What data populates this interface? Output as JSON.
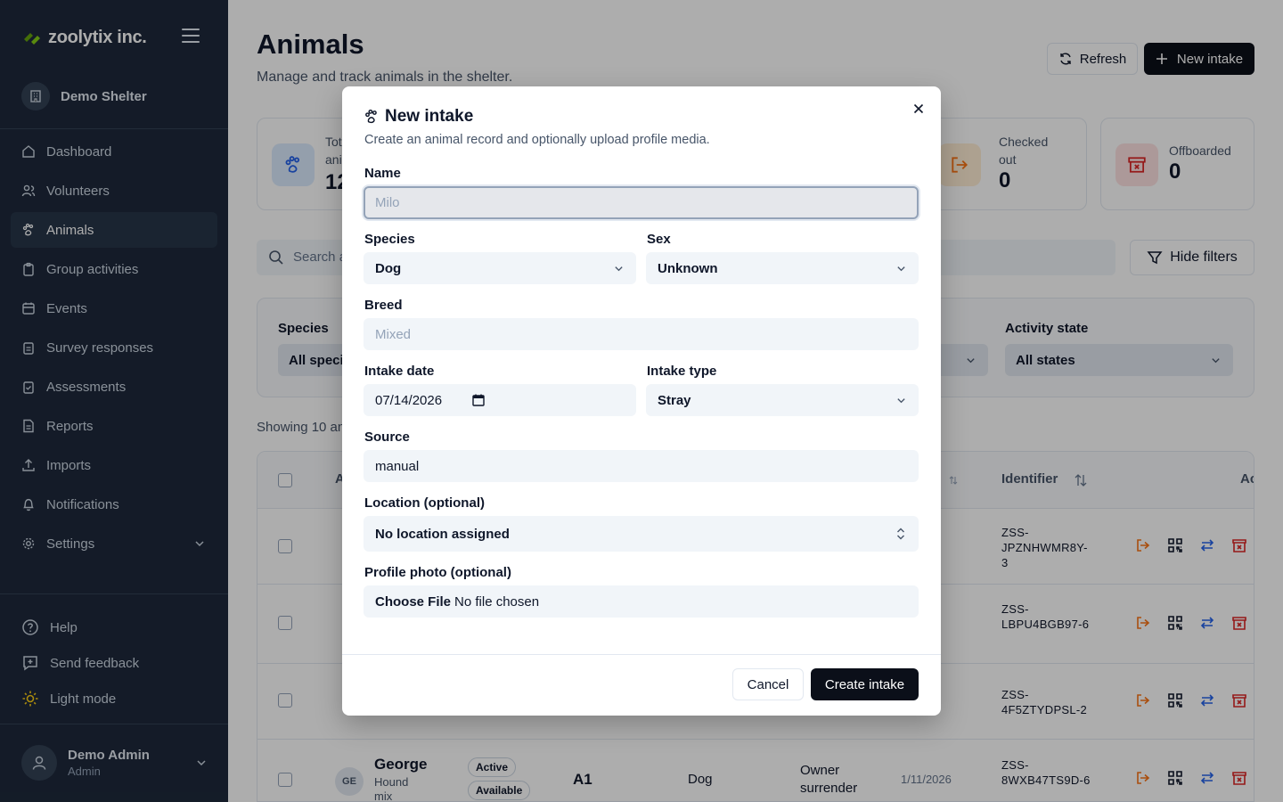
{
  "sidebar": {
    "brand": "zoolytix inc.",
    "org": "Demo Shelter",
    "nav": [
      {
        "label": "Dashboard",
        "icon": "home-icon"
      },
      {
        "label": "Volunteers",
        "icon": "users-icon"
      },
      {
        "label": "Animals",
        "icon": "paw-icon",
        "active": true
      },
      {
        "label": "Group activities",
        "icon": "clipboard-icon"
      },
      {
        "label": "Events",
        "icon": "calendar-icon"
      },
      {
        "label": "Survey responses",
        "icon": "clipboard-icon"
      },
      {
        "label": "Assessments",
        "icon": "clipboard-check-icon"
      },
      {
        "label": "Reports",
        "icon": "file-icon"
      },
      {
        "label": "Imports",
        "icon": "upload-icon"
      },
      {
        "label": "Notifications",
        "icon": "bell-icon"
      },
      {
        "label": "Settings",
        "icon": "gear-icon"
      }
    ],
    "help": "Help",
    "feedback": "Send feedback",
    "theme": "Light mode",
    "user_name": "Demo Admin",
    "user_role": "Admin"
  },
  "header": {
    "title": "Animals",
    "subtitle": "Manage and track animals in the shelter.",
    "refresh_label": "Refresh",
    "new_intake_label": "New intake"
  },
  "stats": [
    {
      "label_line1": "Tot",
      "label_line2": "ani",
      "value": "12"
    },
    {
      "label_line1": "Checked",
      "label_line2": "out",
      "value": "0"
    },
    {
      "label_line1": "Offboarded",
      "label_line2": "",
      "value": "0"
    }
  ],
  "search": {
    "placeholder": "Search a"
  },
  "hide_filters_label": "Hide filters",
  "filters": {
    "species_label": "Species",
    "species_value": "All speci",
    "activity_label": "Activity state",
    "activity_value": "All states"
  },
  "showing_text": "Showing 10 an",
  "table": {
    "headers": {
      "col2": "A",
      "identifier": "Identifier",
      "actions": "Ac"
    },
    "rows": [
      {
        "date": "26",
        "identifier": "ZSS-JPZNHWMR8Y-3"
      },
      {
        "date": "26",
        "identifier": "ZSS-LBPU4BGB97-6"
      },
      {
        "date": "26",
        "identifier": "ZSS-4F5ZTYDPSL-2"
      },
      {
        "initials": "GE",
        "name": "George",
        "breed": "Hound mix",
        "status1": "Active",
        "status2": "Available",
        "location": "A1",
        "species": "Dog",
        "intake": "Owner surrender",
        "date": "1/11/2026",
        "identifier": "ZSS-8WXB47TS9D-6"
      }
    ]
  },
  "modal": {
    "title": "New intake",
    "description": "Create an animal record and optionally upload profile media.",
    "name_label": "Name",
    "name_placeholder": "Milo",
    "species_label": "Species",
    "species_value": "Dog",
    "sex_label": "Sex",
    "sex_value": "Unknown",
    "breed_label": "Breed",
    "breed_placeholder": "Mixed",
    "intake_date_label": "Intake date",
    "intake_date_value": "07/14/2026",
    "intake_type_label": "Intake type",
    "intake_type_value": "Stray",
    "source_label": "Source",
    "source_value": "manual",
    "location_label": "Location (optional)",
    "location_value": "No location assigned",
    "photo_label": "Profile photo (optional)",
    "photo_button": "Choose File",
    "photo_status": "No file chosen",
    "cancel_label": "Cancel",
    "create_label": "Create intake"
  },
  "colors": {
    "sidebar_bg": "#1e293b",
    "brand_green": "#65a30d",
    "primary_dark": "#0b0f19",
    "action_orange": "#f97316",
    "action_blue": "#2563eb",
    "action_red": "#dc2626"
  }
}
